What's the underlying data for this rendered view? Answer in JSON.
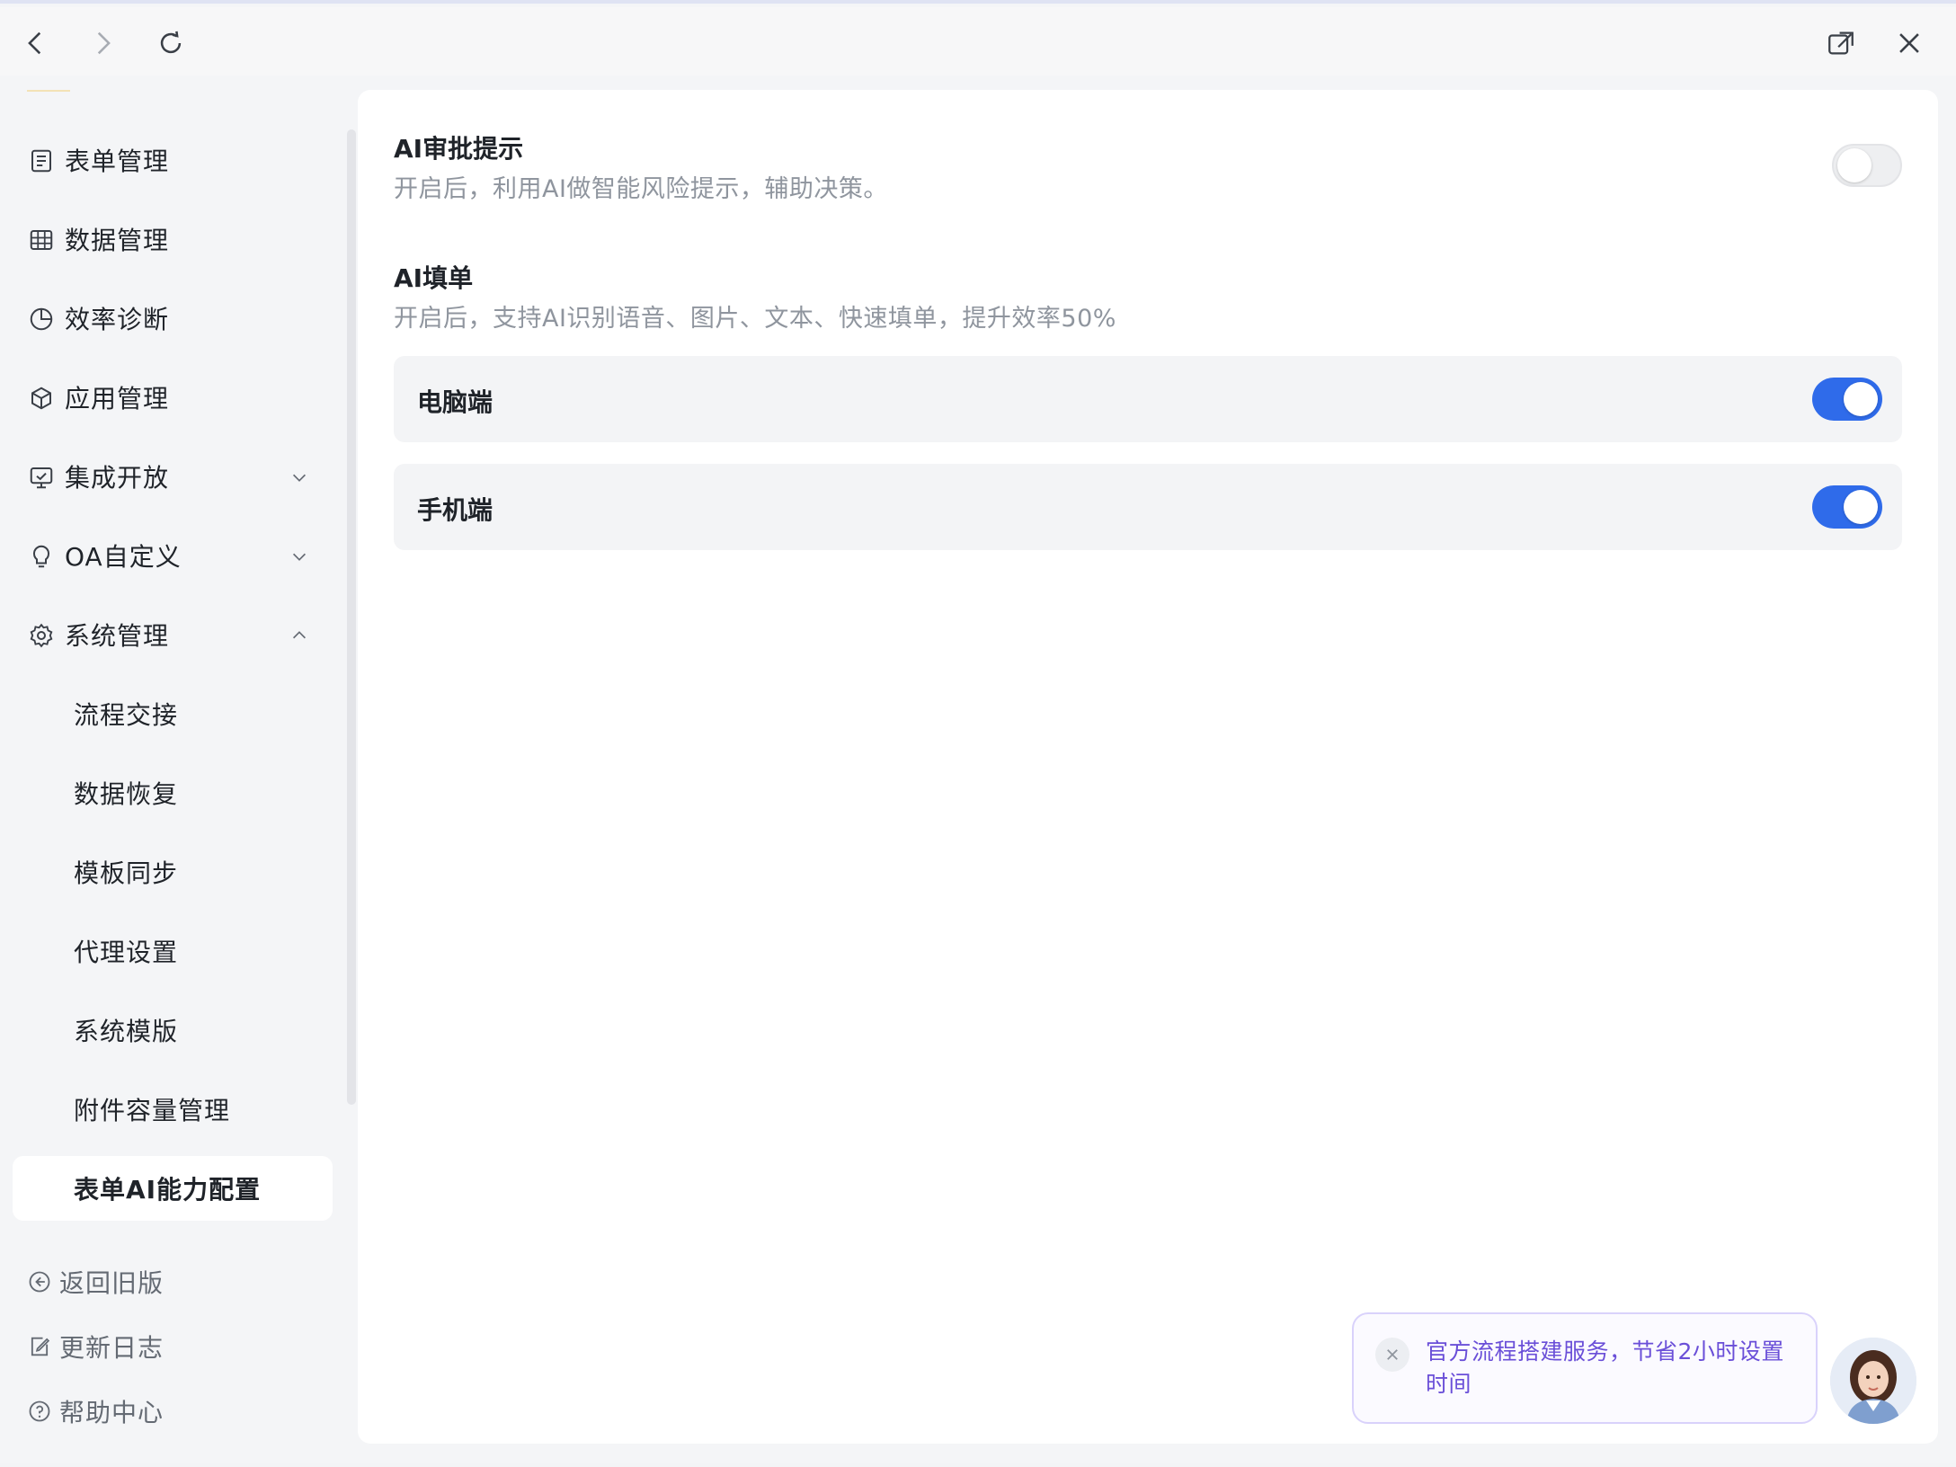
{
  "sidebar": {
    "items": [
      {
        "label": "表单管理",
        "icon": "form-icon"
      },
      {
        "label": "数据管理",
        "icon": "table-icon"
      },
      {
        "label": "效率诊断",
        "icon": "pie-chart-icon"
      },
      {
        "label": "应用管理",
        "icon": "cube-icon"
      },
      {
        "label": "集成开放",
        "icon": "monitor-icon"
      },
      {
        "label": "OA自定义",
        "icon": "bulb-icon"
      },
      {
        "label": "系统管理",
        "icon": "gear-icon"
      }
    ],
    "sub_items": [
      {
        "label": "流程交接"
      },
      {
        "label": "数据恢复"
      },
      {
        "label": "模板同步"
      },
      {
        "label": "代理设置"
      },
      {
        "label": "系统模版"
      },
      {
        "label": "附件容量管理"
      },
      {
        "label": "表单AI能力配置",
        "active": true
      }
    ],
    "footer": [
      {
        "label": "返回旧版",
        "icon": "back-circle-icon"
      },
      {
        "label": "更新日志",
        "icon": "edit-note-icon"
      },
      {
        "label": "帮助中心",
        "icon": "help-icon"
      }
    ]
  },
  "main": {
    "ai_approval": {
      "title": "AI审批提示",
      "desc": "开启后，利用AI做智能风险提示，辅助决策。",
      "enabled": false
    },
    "ai_fill": {
      "title": "AI填单",
      "desc": "开启后，支持AI识别语音、图片、文本、快速填单，提升效率50%",
      "rows": [
        {
          "label": "电脑端",
          "enabled": true
        },
        {
          "label": "手机端",
          "enabled": true
        }
      ]
    }
  },
  "promo": {
    "text": "官方流程搭建服务，节省2小时设置时间"
  },
  "colors": {
    "accent": "#2f6bea",
    "promo_text": "#6a4fd8"
  }
}
